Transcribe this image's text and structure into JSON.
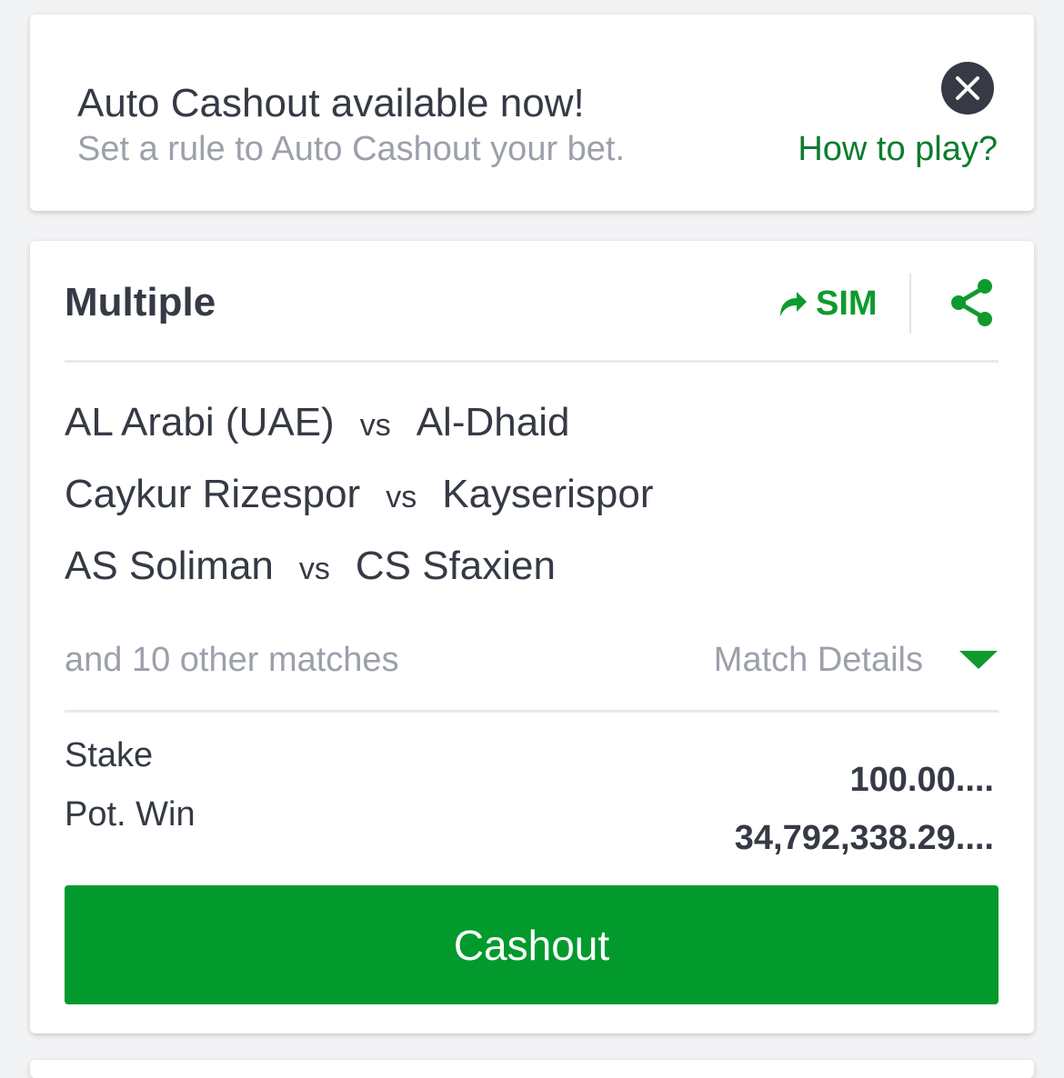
{
  "banner": {
    "title": "Auto Cashout available now!",
    "subtitle": "Set a rule to Auto Cashout your bet.",
    "how_to_play": "How to play?",
    "close_icon": "close-icon"
  },
  "bet": {
    "type": "Multiple",
    "sim_label": "SIM",
    "sim_icon": "share-arrow-icon",
    "share_icon": "share-icon",
    "matches": [
      {
        "home": "AL Arabi (UAE)",
        "vs": "vs",
        "away": "Al-Dhaid"
      },
      {
        "home": "Caykur Rizespor",
        "vs": "vs",
        "away": "Kayserispor"
      },
      {
        "home": "AS Soliman",
        "vs": "vs",
        "away": "CS Sfaxien"
      }
    ],
    "other_matches": "and 10 other matches",
    "match_details": "Match Details",
    "stake_label": "Stake",
    "stake_value": "100.00....",
    "pot_win_label": "Pot. Win",
    "pot_win_value": "34,792,338.29....",
    "cashout_label": "Cashout"
  },
  "colors": {
    "accent_green": "#029a2c",
    "link_green": "#0d7c2e",
    "text_dark": "#353a45",
    "text_muted": "#9ca0ab"
  }
}
